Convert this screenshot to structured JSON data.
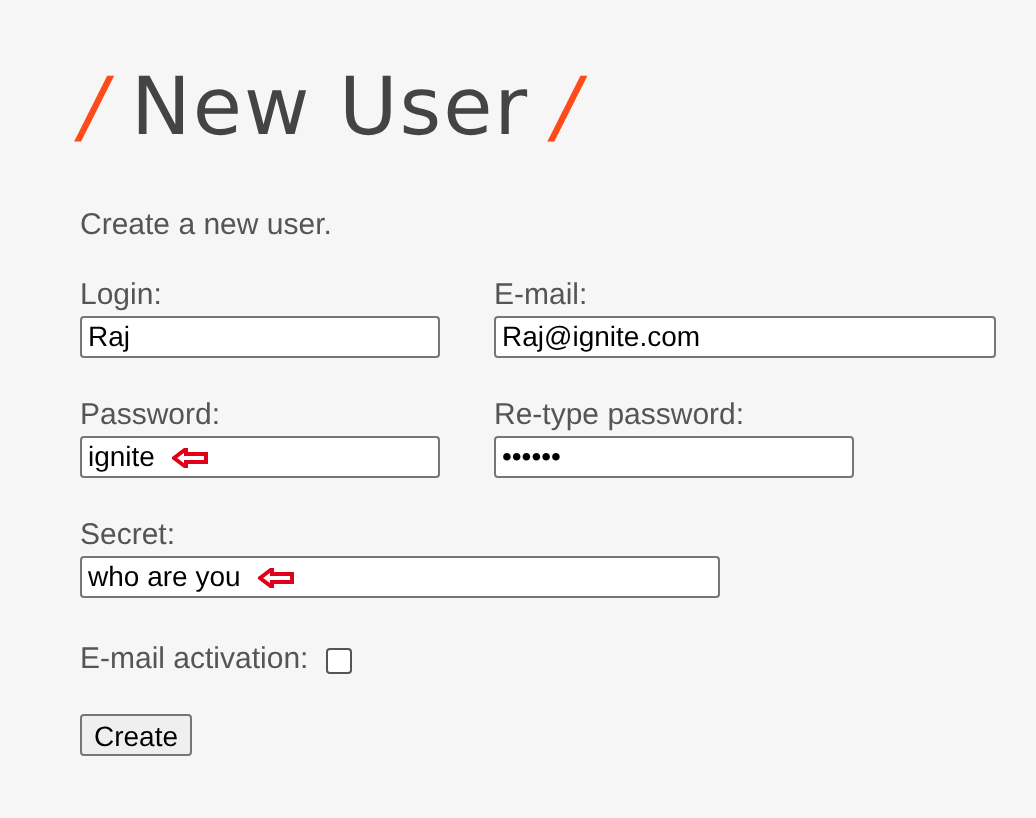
{
  "heading": {
    "mark_left": "/",
    "title": "New User",
    "mark_right": "/"
  },
  "intro": "Create a new user.",
  "rows": [
    {
      "fields": [
        {
          "kind": "text",
          "label": "Login:",
          "value": "Raj",
          "arrow": false
        },
        {
          "kind": "text",
          "label": "E-mail:",
          "value": "Raj@ignite.com",
          "arrow": false
        }
      ]
    },
    {
      "fields": [
        {
          "kind": "text",
          "label": "Password:",
          "value": "ignite",
          "arrow": true
        },
        {
          "kind": "text",
          "label": "Re-type password:",
          "value": "••••••",
          "arrow": false
        }
      ]
    },
    {
      "fields": [
        {
          "kind": "text",
          "label": "Secret:",
          "value": "who are you",
          "arrow": true
        }
      ]
    },
    {
      "fields": [
        {
          "kind": "checkbox",
          "label": "E-mail activation:",
          "checked": false
        }
      ]
    }
  ],
  "button": "Create"
}
